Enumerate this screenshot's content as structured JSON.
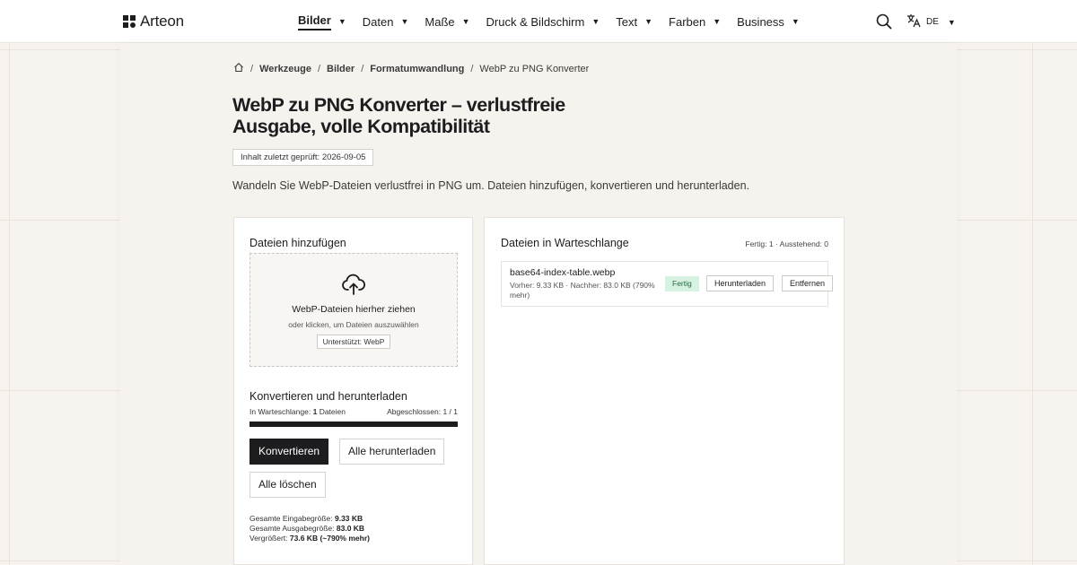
{
  "header": {
    "logo_text": "Arteon",
    "nav": [
      {
        "label": "Bilder",
        "active": true
      },
      {
        "label": "Daten"
      },
      {
        "label": "Maße"
      },
      {
        "label": "Druck & Bildschirm"
      },
      {
        "label": "Text"
      },
      {
        "label": "Farben"
      },
      {
        "label": "Business"
      }
    ],
    "caret": "▼",
    "language": "DE",
    "icons": [
      "search-icon",
      "translate-icon",
      "home-icon",
      "cloud-upload-icon"
    ]
  },
  "breadcrumb": {
    "items": [
      "Werkzeuge",
      "Bilder",
      "Formatumwandlung",
      "WebP zu PNG Konverter"
    ],
    "separator": "/"
  },
  "page": {
    "title": "WebP zu PNG Konverter – verlustfreie Ausgabe, volle Kompatibilität",
    "reviewed": "Inhalt zuletzt geprüft: 2026-09-05",
    "lead": "Wandeln Sie WebP-Dateien verlustfrei in PNG um. Dateien hinzufügen, konvertieren und herunterladen."
  },
  "add_files": {
    "title": "Dateien hinzufügen",
    "drop_main": "WebP-Dateien hierher ziehen",
    "drop_sub": "oder klicken, um Dateien auszuwählen",
    "supported": "Unterstützt: WebP"
  },
  "convert": {
    "title": "Konvertieren und herunterladen",
    "queue_label": "In Warteschlange:",
    "queue_count": "1",
    "queue_unit": "Dateien",
    "completed": "Abgeschlossen: 1 / 1",
    "progress_fraction": 1.0,
    "btn_convert": "Konvertieren",
    "btn_download_all": "Alle herunterladen",
    "btn_clear": "Alle löschen",
    "stats": {
      "input_label": "Gesamte Eingabegröße:",
      "input_value": "9.33 KB",
      "output_label": "Gesamte Ausgabegröße:",
      "output_value": "83.0 KB",
      "change_label": "Vergrößert:",
      "change_value": "73.6 KB (~790% mehr)"
    }
  },
  "queue": {
    "title": "Dateien in Warteschlange",
    "status": "Fertig: 1 · Ausstehend: 0",
    "files": [
      {
        "name": "base64-index-table.webp",
        "meta": "Vorher: 9.33 KB · Nachher: 83.0 KB (790% mehr)",
        "status": "Fertig",
        "download": "Herunterladen",
        "remove": "Entfernen"
      }
    ]
  },
  "colors": {
    "accent": "#1d1d1f",
    "background": "#f7f4ef",
    "success_bg": "#d7f2e1",
    "success_text": "#1e6b3c"
  }
}
